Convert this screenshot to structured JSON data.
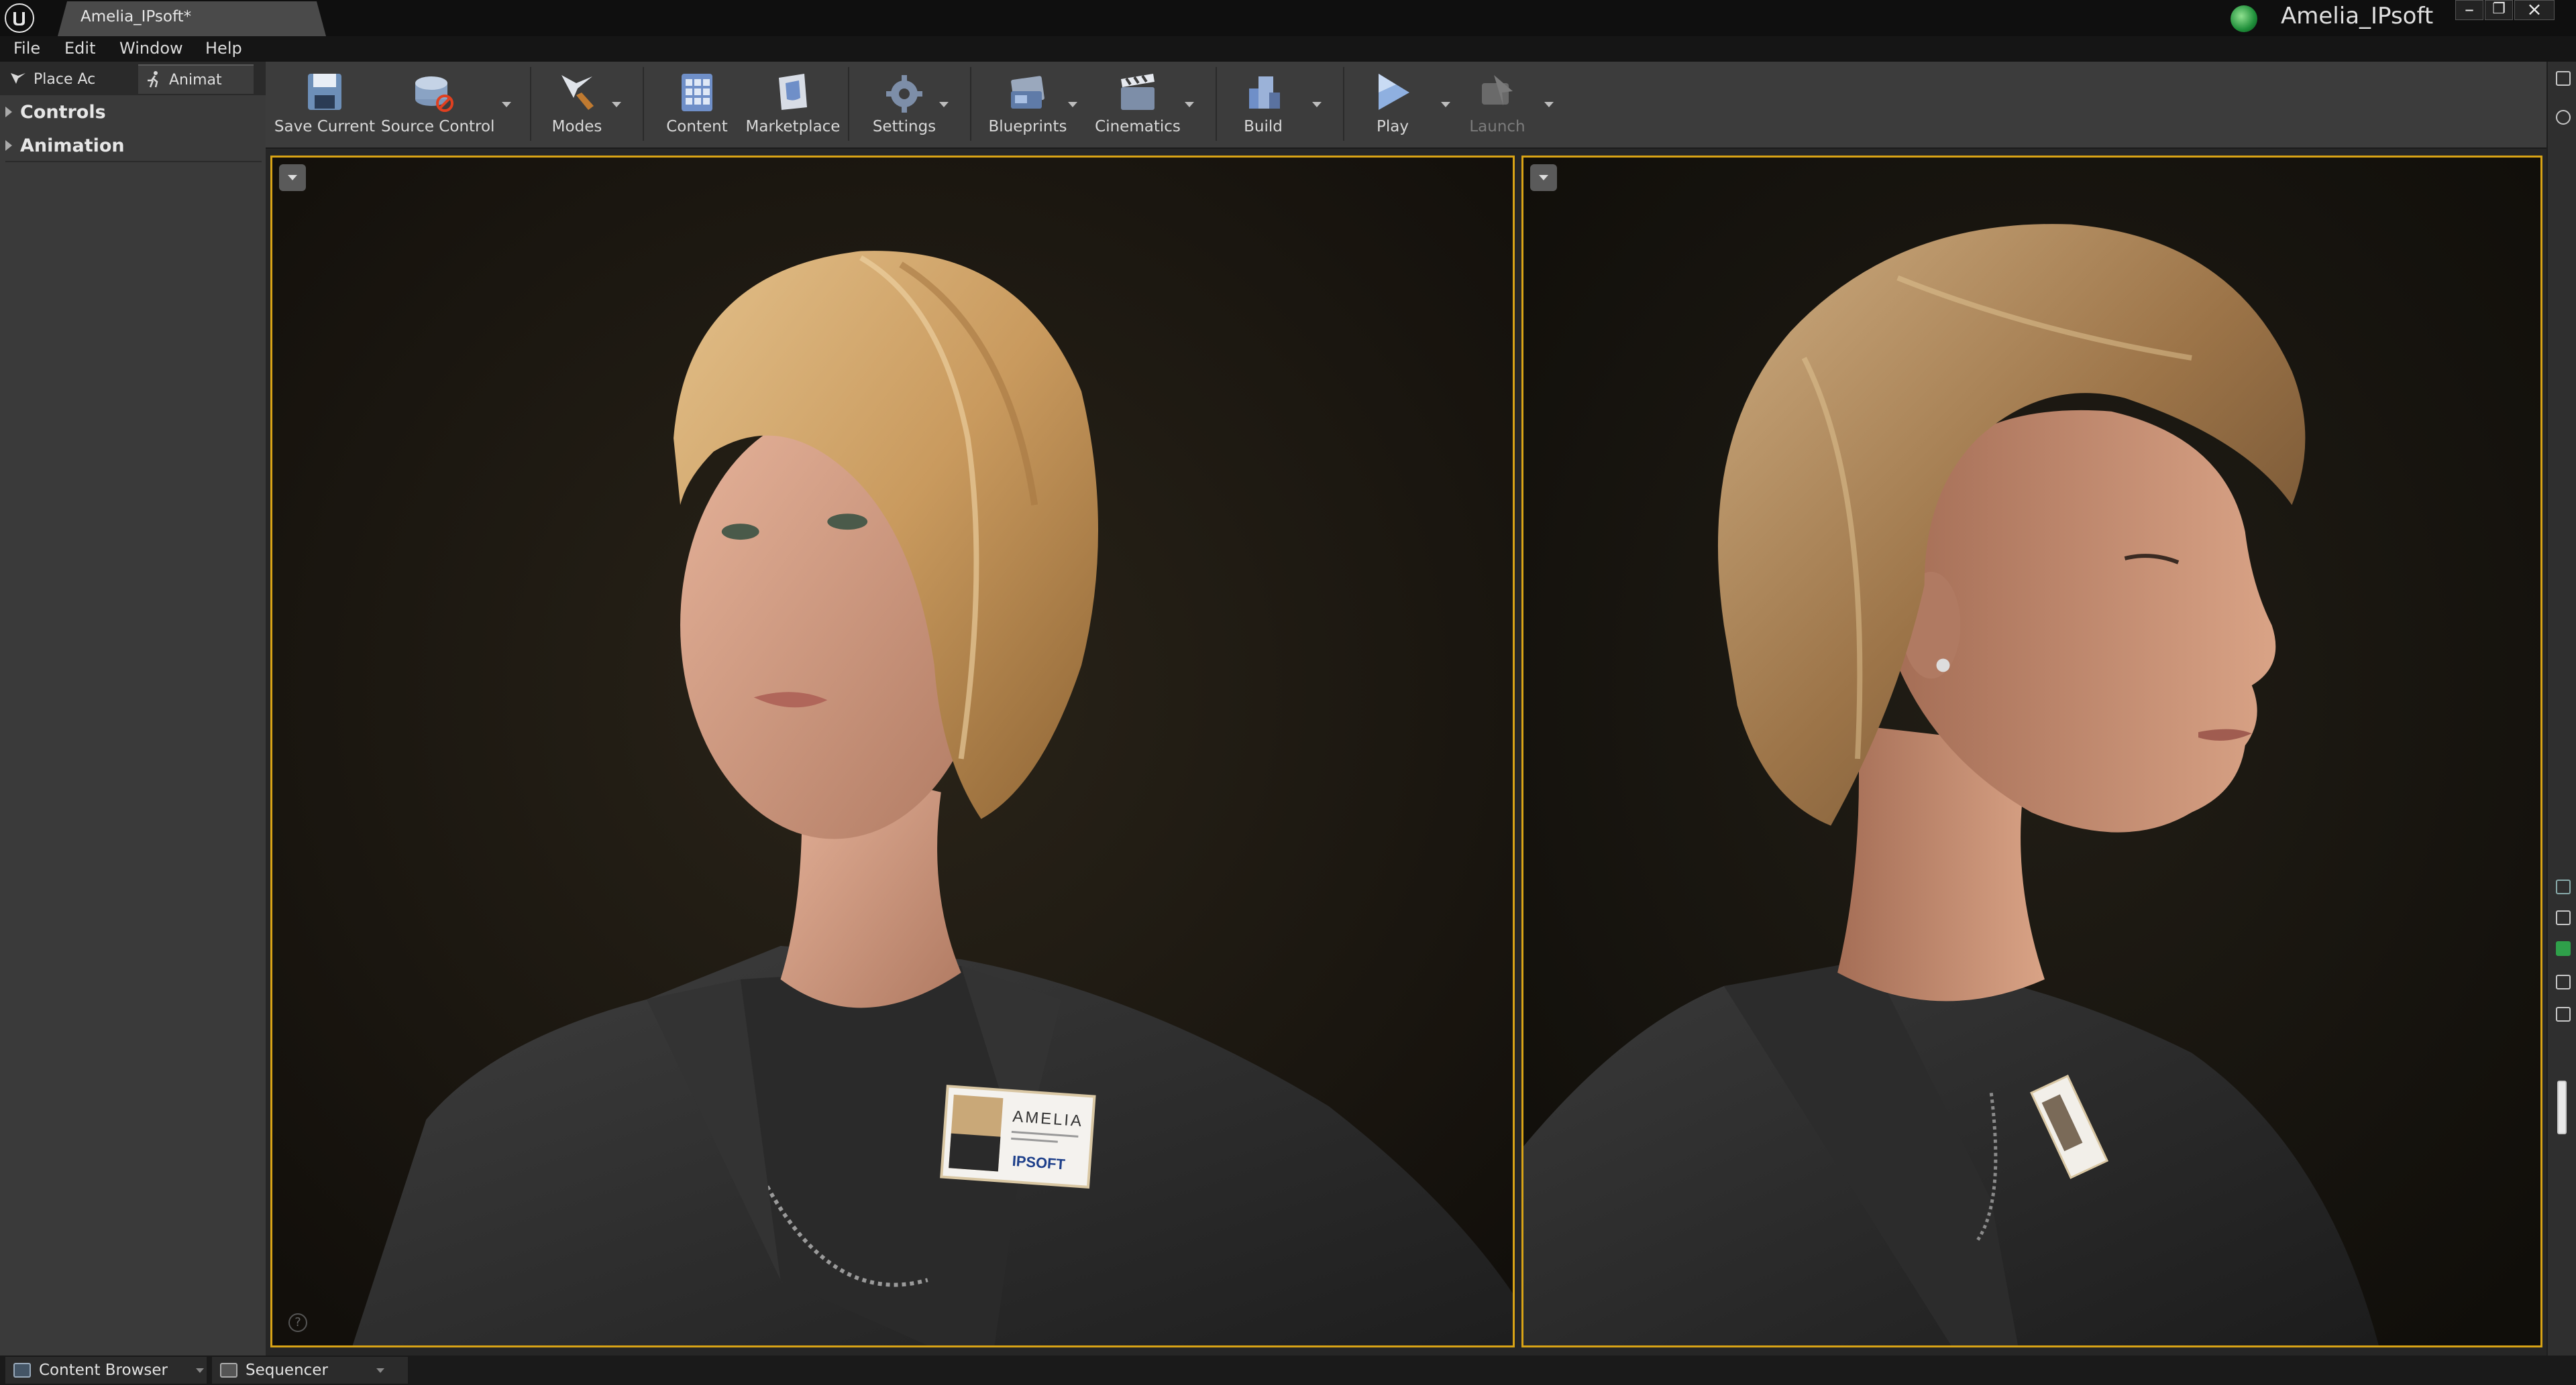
{
  "titlebar": {
    "doc_tab": "Amelia_IPsoft*",
    "project_name": "Amelia_IPsoft",
    "window_buttons": [
      "minimize",
      "restore",
      "close"
    ]
  },
  "menu": {
    "items": [
      "File",
      "Edit",
      "Window",
      "Help"
    ]
  },
  "modes": {
    "place": "Place Ac",
    "animate": "Animat"
  },
  "tree": {
    "items": [
      "Controls",
      "Animation"
    ]
  },
  "toolbar": {
    "buttons": [
      {
        "label": "Save Current",
        "icon": "save-icon",
        "dropdown": false
      },
      {
        "label": "Source Control",
        "icon": "source-control-icon",
        "dropdown": true
      },
      {
        "label": "Modes",
        "icon": "modes-icon",
        "dropdown": true
      },
      {
        "label": "Content",
        "icon": "content-icon",
        "dropdown": false
      },
      {
        "label": "Marketplace",
        "icon": "marketplace-icon",
        "dropdown": false
      },
      {
        "label": "Settings",
        "icon": "settings-icon",
        "dropdown": true
      },
      {
        "label": "Blueprints",
        "icon": "blueprints-icon",
        "dropdown": true
      },
      {
        "label": "Cinematics",
        "icon": "cinematics-icon",
        "dropdown": true
      },
      {
        "label": "Build",
        "icon": "build-icon",
        "dropdown": true
      },
      {
        "label": "Play",
        "icon": "play-icon",
        "dropdown": true
      },
      {
        "label": "Launch",
        "icon": "launch-icon",
        "dropdown": true,
        "disabled": true
      }
    ]
  },
  "viewports": {
    "left": {
      "badge_name": "AMELIA",
      "badge_company": "IPSOFT"
    },
    "right": {}
  },
  "bottom": {
    "tabs": [
      "Content Browser",
      "Sequencer"
    ]
  },
  "colors": {
    "viewport_border": "#d8a316",
    "toolbar_bg": "#3c3c3c",
    "panel_bg": "#3a3a3a"
  }
}
